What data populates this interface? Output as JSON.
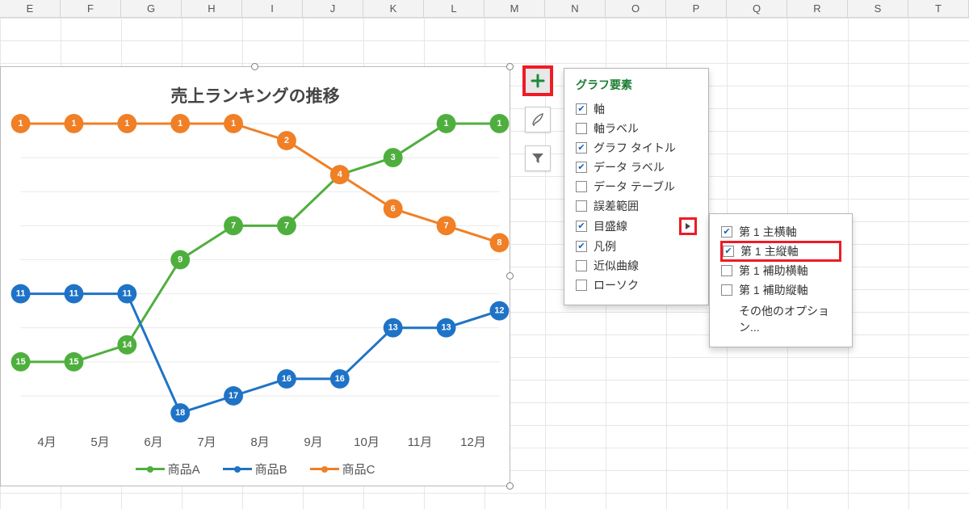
{
  "columns": [
    "E",
    "F",
    "G",
    "H",
    "I",
    "J",
    "K",
    "L",
    "M",
    "N",
    "O",
    "P",
    "Q",
    "R",
    "S",
    "T"
  ],
  "chart": {
    "title": "売上ランキングの推移",
    "legend": [
      "商品A",
      "商品B",
      "商品C"
    ]
  },
  "chart_data": {
    "type": "line",
    "title": "売上ランキングの推移",
    "categories": [
      "4月",
      "5月",
      "6月",
      "7月",
      "8月",
      "9月",
      "10月",
      "11月",
      "12月"
    ],
    "series": [
      {
        "name": "商品A",
        "color": "#4faf3e",
        "values": [
          15,
          15,
          14,
          9,
          7,
          7,
          4,
          3,
          1,
          1
        ]
      },
      {
        "name": "商品B",
        "color": "#1f73c6",
        "values": [
          11,
          11,
          11,
          18,
          17,
          16,
          16,
          13,
          13,
          12
        ]
      },
      {
        "name": "商品C",
        "color": "#f07f26",
        "values": [
          1,
          1,
          1,
          1,
          1,
          2,
          4,
          6,
          7,
          8
        ]
      }
    ],
    "ylim_rank": [
      1,
      18
    ],
    "y_axis_reversed": true,
    "data_labels": true
  },
  "fab": {
    "plus": "chart-elements-button",
    "brush": "chart-styles-button",
    "filter": "chart-filter-button"
  },
  "chart_elements_popup": {
    "title": "グラフ要素",
    "options": [
      {
        "label": "軸",
        "checked": true
      },
      {
        "label": "軸ラベル",
        "checked": false
      },
      {
        "label": "グラフ タイトル",
        "checked": true
      },
      {
        "label": "データ ラベル",
        "checked": true
      },
      {
        "label": "データ テーブル",
        "checked": false
      },
      {
        "label": "誤差範囲",
        "checked": false
      },
      {
        "label": "目盛線",
        "checked": true,
        "has_submenu": true
      },
      {
        "label": "凡例",
        "checked": true
      },
      {
        "label": "近似曲線",
        "checked": false
      },
      {
        "label": "ローソク",
        "checked": false
      }
    ]
  },
  "gridlines_submenu": {
    "options": [
      {
        "label": "第 1 主横軸",
        "checked": true
      },
      {
        "label": "第 1 主縦軸",
        "checked": true,
        "highlight": true
      },
      {
        "label": "第 1 補助横軸",
        "checked": false
      },
      {
        "label": "第 1 補助縦軸",
        "checked": false
      }
    ],
    "more": "その他のオプション..."
  }
}
